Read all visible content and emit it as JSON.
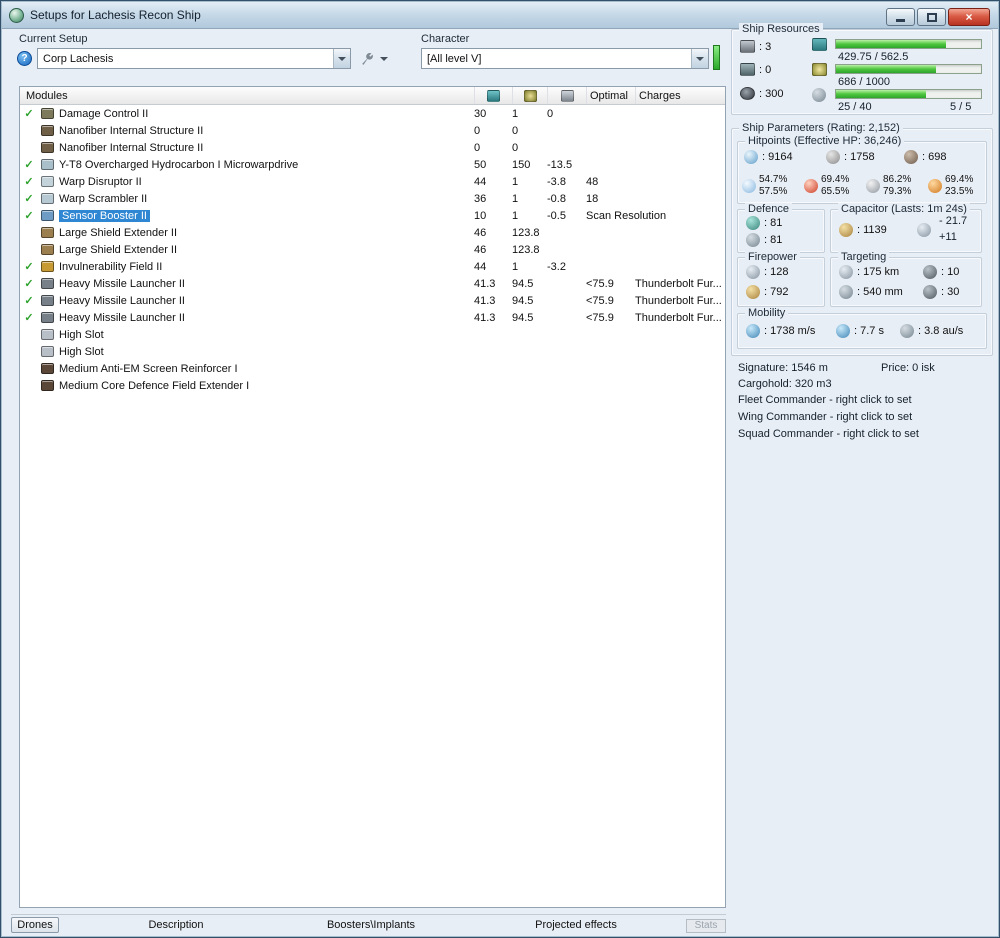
{
  "window": {
    "title": "Setups for Lachesis Recon Ship"
  },
  "icons": {
    "help": "?",
    "close": "×"
  },
  "setup": {
    "label": "Current Setup",
    "value": "Corp Lachesis"
  },
  "character": {
    "label": "Character",
    "value": "[All level V]"
  },
  "ship_resources": {
    "label": "Ship Resources",
    "turrets": ": 3",
    "launchers": ": 0",
    "upgrades": ": 300",
    "cpu": {
      "text": "429.75 / 562.5",
      "pct": 76
    },
    "powergrid": {
      "text": "686 / 1000",
      "pct": 69
    },
    "dronebay": {
      "text": "25 / 40",
      "pct": 62,
      "drones": "5 / 5"
    }
  },
  "modules_table": {
    "title": "Modules",
    "col_optimal": "Optimal",
    "col_charges": "Charges",
    "check_glyph": "✓",
    "rows": [
      {
        "active": true,
        "selected": false,
        "name": "Damage Control II",
        "icon_color": "#7d7a5c",
        "cpu": "30",
        "pg": "1",
        "cap": "0",
        "optimal": "",
        "charges": ""
      },
      {
        "active": false,
        "selected": false,
        "name": "Nanofiber Internal Structure II",
        "icon_color": "#6e5f46",
        "cpu": "0",
        "pg": "0",
        "cap": "",
        "optimal": "",
        "charges": ""
      },
      {
        "active": false,
        "selected": false,
        "name": "Nanofiber Internal Structure II",
        "icon_color": "#6e5f46",
        "cpu": "0",
        "pg": "0",
        "cap": "",
        "optimal": "",
        "charges": ""
      },
      {
        "active": true,
        "selected": false,
        "name": "Y-T8 Overcharged Hydrocarbon I Microwarpdrive",
        "icon_color": "#a9bfca",
        "cpu": "50",
        "pg": "150",
        "cap": "-13.5",
        "optimal": "",
        "charges": ""
      },
      {
        "active": true,
        "selected": false,
        "name": "Warp Disruptor II",
        "icon_color": "#c4d3da",
        "cpu": "44",
        "pg": "1",
        "cap": "-3.8",
        "optimal": "48",
        "charges": ""
      },
      {
        "active": true,
        "selected": false,
        "name": "Warp Scrambler II",
        "icon_color": "#b7c9d2",
        "cpu": "36",
        "pg": "1",
        "cap": "-0.8",
        "optimal": "18",
        "charges": ""
      },
      {
        "active": true,
        "selected": true,
        "name": "Sensor Booster II",
        "icon_color": "#6f9cc4",
        "cpu": "10",
        "pg": "1",
        "cap": "-0.5",
        "optimal": "Scan Resolution",
        "charges": ""
      },
      {
        "active": false,
        "selected": false,
        "name": "Large Shield Extender II",
        "icon_color": "#9c7f4e",
        "cpu": "46",
        "pg": "123.8",
        "cap": "",
        "optimal": "",
        "charges": ""
      },
      {
        "active": false,
        "selected": false,
        "name": "Large Shield Extender II",
        "icon_color": "#9c7f4e",
        "cpu": "46",
        "pg": "123.8",
        "cap": "",
        "optimal": "",
        "charges": ""
      },
      {
        "active": true,
        "selected": false,
        "name": "Invulnerability Field II",
        "icon_color": "#c79a33",
        "cpu": "44",
        "pg": "1",
        "cap": "-3.2",
        "optimal": "",
        "charges": ""
      },
      {
        "active": true,
        "selected": false,
        "name": "Heavy Missile Launcher II",
        "icon_color": "#778089",
        "cpu": "41.3",
        "pg": "94.5",
        "cap": "",
        "optimal": "<75.9",
        "charges": "Thunderbolt Fur..."
      },
      {
        "active": true,
        "selected": false,
        "name": "Heavy Missile Launcher II",
        "icon_color": "#778089",
        "cpu": "41.3",
        "pg": "94.5",
        "cap": "",
        "optimal": "<75.9",
        "charges": "Thunderbolt Fur..."
      },
      {
        "active": true,
        "selected": false,
        "name": "Heavy Missile Launcher II",
        "icon_color": "#778089",
        "cpu": "41.3",
        "pg": "94.5",
        "cap": "",
        "optimal": "<75.9",
        "charges": "Thunderbolt Fur..."
      },
      {
        "active": false,
        "selected": false,
        "name": "High Slot",
        "icon_color": "#b9bfc6",
        "cpu": "",
        "pg": "",
        "cap": "",
        "optimal": "",
        "charges": ""
      },
      {
        "active": false,
        "selected": false,
        "name": "High Slot",
        "icon_color": "#b9bfc6",
        "cpu": "",
        "pg": "",
        "cap": "",
        "optimal": "",
        "charges": ""
      },
      {
        "active": false,
        "selected": false,
        "name": "Medium Anti-EM Screen Reinforcer I",
        "icon_color": "#5a4738",
        "cpu": "",
        "pg": "",
        "cap": "",
        "optimal": "",
        "charges": ""
      },
      {
        "active": false,
        "selected": false,
        "name": "Medium Core Defence Field Extender I",
        "icon_color": "#5a4738",
        "cpu": "",
        "pg": "",
        "cap": "",
        "optimal": "",
        "charges": ""
      }
    ]
  },
  "tabs": {
    "drones": "Drones",
    "description": "Description",
    "boosters": "Boosters\\Implants",
    "projected": "Projected effects",
    "stats": "Stats"
  },
  "parameters": {
    "title": "Ship Parameters (Rating: 2,152)",
    "hitpoints": {
      "title": "Hitpoints (Effective HP: 36,246)",
      "shield": ": 9164",
      "armor": ": 1758",
      "hull": ": 698",
      "resists": [
        {
          "shield": "54.7%",
          "armor": "57.5%"
        },
        {
          "shield": "69.4%",
          "armor": "65.5%"
        },
        {
          "shield": "86.2%",
          "armor": "79.3%"
        },
        {
          "shield": "69.4%",
          "armor": "23.5%"
        }
      ]
    },
    "defence": {
      "title": "Defence",
      "v1": ": 81",
      "v2": ": 81"
    },
    "capacitor": {
      "title": "Capacitor (Lasts: 1m 24s)",
      "amount": ": 1139",
      "drain": "- 21.7",
      "recharge": "+11"
    },
    "firepower": {
      "title": "Firepower",
      "volley": ": 128",
      "dps": ": 792"
    },
    "targeting": {
      "title": "Targeting",
      "range": ": 175 km",
      "max_targets": ": 10",
      "scan_res": ": 540 mm",
      "sensor": ": 30"
    },
    "mobility": {
      "title": "Mobility",
      "speed": ": 1738 m/s",
      "align": ": 7.7 s",
      "warp": ": 3.8 au/s"
    },
    "signature": "Signature: 1546 m",
    "price": "Price: 0 isk",
    "cargohold": "Cargohold: 320 m3",
    "fleet": "Fleet Commander - right click to set",
    "wing": "Wing Commander - right click to set",
    "squad": "Squad Commander - right click to set"
  },
  "colors": {
    "window_bg": "#e8eef6",
    "titlebar": "#c2d6e6",
    "selection_blue": "#2f86d2",
    "check_green": "#2fa32f",
    "progress_green": "#3fbf3f",
    "close_red": "#b93322"
  }
}
